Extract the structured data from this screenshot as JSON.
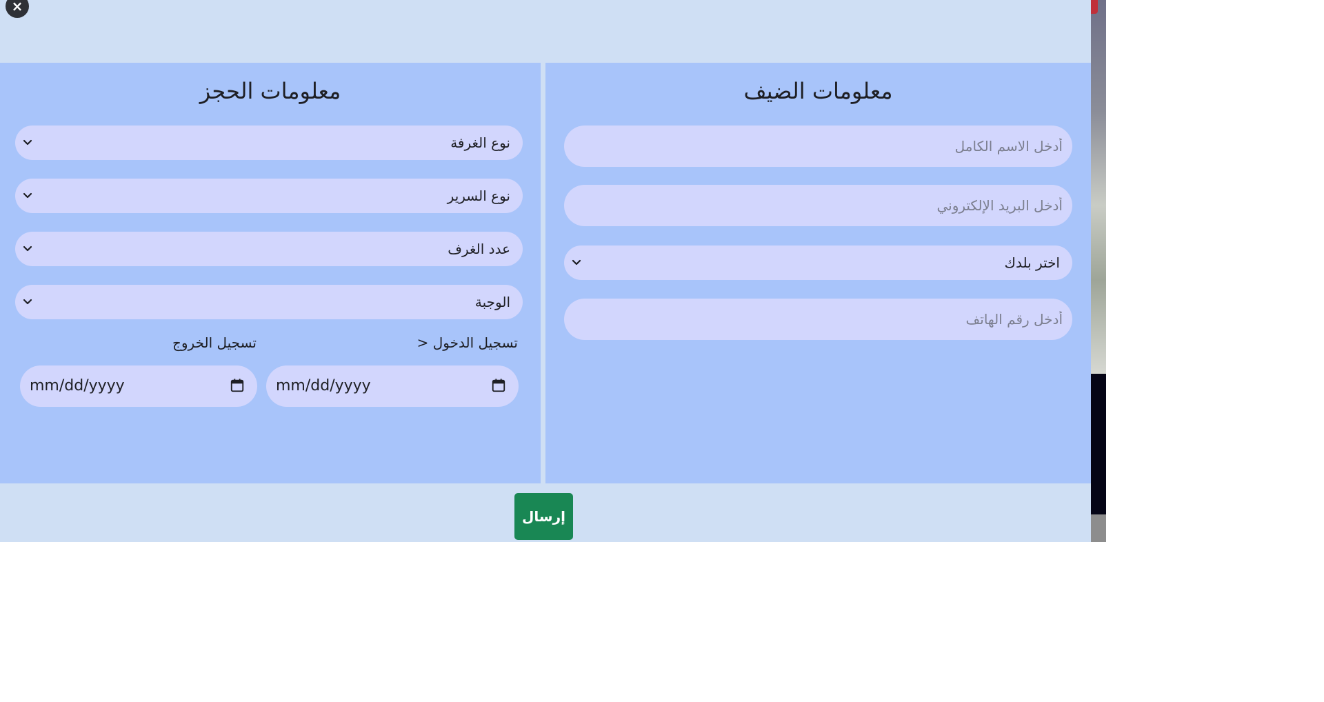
{
  "modal": {
    "close_glyph": "×",
    "submit_label": "إرسال",
    "colors": {
      "modal_bg": "#cfdff4",
      "panel_bg": "#a8c4fa",
      "field_bg": "#d2d6fd",
      "submit_bg": "#198754",
      "close_bg": "#2f3136"
    }
  },
  "guest": {
    "title": "معلومات الضيف",
    "full_name_placeholder": "أدخل الاسم الكامل",
    "email_placeholder": "أدخل البريد الإلكتروني",
    "country_select": "اختر بلدك",
    "phone_placeholder": "أدخل رقم الهاتف"
  },
  "booking": {
    "title": "معلومات الحجز",
    "room_type_select": "نوع الغرفة",
    "bed_type_select": "نوع السرير",
    "room_count_select": "عدد الغرف",
    "meal_select": "الوجبة",
    "checkin_label": "تسجيل الدخول <",
    "checkout_label": "تسجيل الخروج",
    "checkin_value": "mm/dd/yyyy",
    "checkout_value": "mm/dd/yyyy"
  },
  "icons": {
    "close": "close-icon",
    "chevron": "chevron-down-icon",
    "calendar": "calendar-icon"
  }
}
